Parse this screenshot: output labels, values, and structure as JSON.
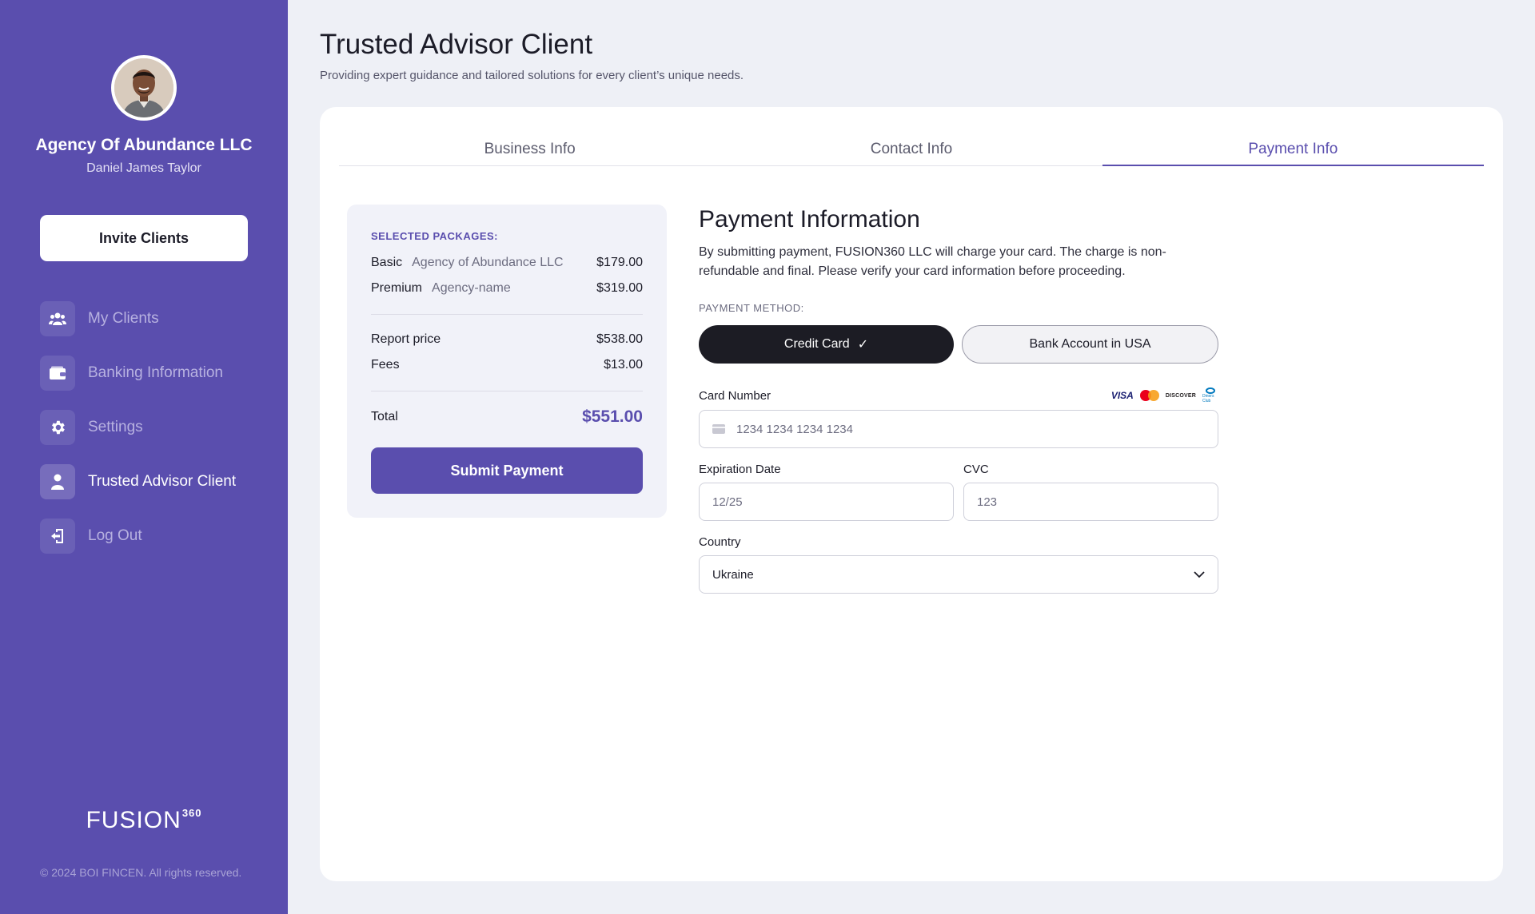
{
  "sidebar": {
    "company_name": "Agency Of Abundance LLC",
    "user_name": "Daniel James Taylor",
    "invite_button": "Invite Clients",
    "nav": [
      {
        "label": "My Clients",
        "icon": "users-icon",
        "active": false
      },
      {
        "label": "Banking Information",
        "icon": "wallet-icon",
        "active": false
      },
      {
        "label": "Settings",
        "icon": "gear-icon",
        "active": false
      },
      {
        "label": "Trusted Advisor Client",
        "icon": "user-icon",
        "active": true
      },
      {
        "label": "Log Out",
        "icon": "logout-icon",
        "active": false
      }
    ],
    "logo_text": "FUSION",
    "logo_sup": "360",
    "copyright": "© 2024 BOI FINCEN. All rights reserved."
  },
  "header": {
    "title": "Trusted Advisor Client",
    "subtitle": "Providing expert guidance and tailored solutions for every client’s unique needs."
  },
  "tabs": [
    {
      "label": "Business Info",
      "active": false
    },
    {
      "label": "Contact Info",
      "active": false
    },
    {
      "label": "Payment Info",
      "active": true
    }
  ],
  "summary": {
    "heading": "SELECTED PACKAGES:",
    "packages": [
      {
        "name": "Basic",
        "client": "Agency of Abundance LLC",
        "price": "$179.00"
      },
      {
        "name": "Premium",
        "client": "Agency-name",
        "price": "$319.00"
      }
    ],
    "report_label": "Report price",
    "report_price": "$538.00",
    "fees_label": "Fees",
    "fees_price": "$13.00",
    "total_label": "Total",
    "total_price": "$551.00",
    "submit_label": "Submit Payment"
  },
  "payment": {
    "title": "Payment Information",
    "description": "By submitting payment, FUSION360 LLC will charge your card. The charge is non-refundable and final. Please verify your card information before proceeding.",
    "method_label": "PAYMENT METHOD:",
    "methods": [
      {
        "label": "Credit Card",
        "selected": true
      },
      {
        "label": "Bank Account in USA",
        "selected": false
      }
    ],
    "card_number_label": "Card Number",
    "card_number_placeholder": "1234 1234 1234 1234",
    "card_brands": [
      "VISA",
      "mastercard",
      "DISCOVER",
      "Diners Club"
    ],
    "expiration_label": "Expiration Date",
    "expiration_placeholder": "12/25",
    "cvc_label": "CVC",
    "cvc_placeholder": "123",
    "country_label": "Country",
    "country_value": "Ukraine"
  },
  "colors": {
    "sidebar_bg": "#5a4eae",
    "accent": "#5a4eae",
    "page_bg": "#eef0f6",
    "selected_method_bg": "#1c1c24"
  }
}
